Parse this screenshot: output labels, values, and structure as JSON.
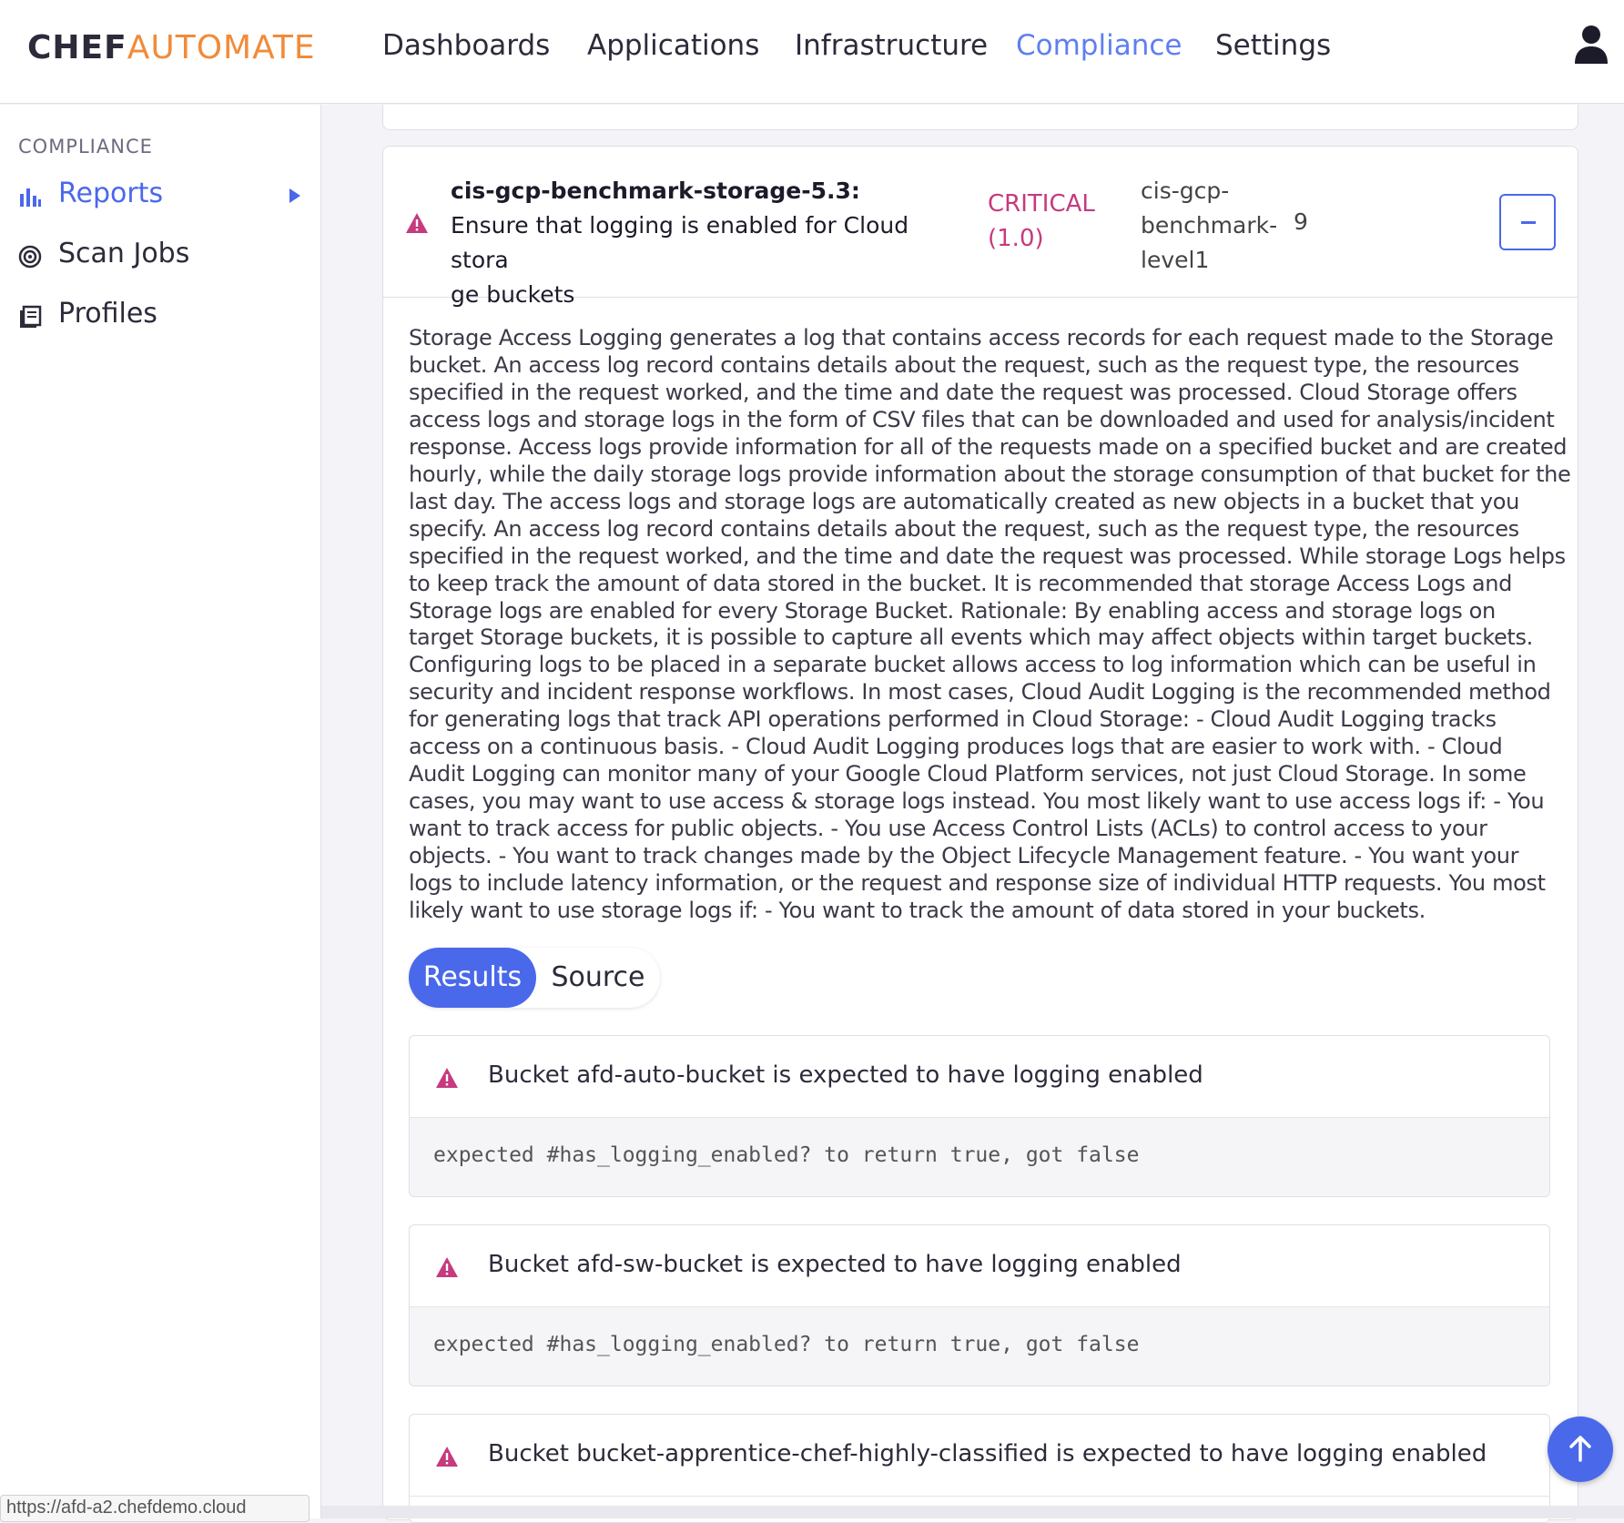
{
  "brand": {
    "part1": "CHEF",
    "part2": "AUTOMATE"
  },
  "nav": {
    "items": [
      {
        "label": "Dashboards",
        "active": false
      },
      {
        "label": "Applications",
        "active": false
      },
      {
        "label": "Infrastructure",
        "active": false
      },
      {
        "label": "Compliance",
        "active": true
      },
      {
        "label": "Settings",
        "active": false
      }
    ]
  },
  "sidebar": {
    "title": "COMPLIANCE",
    "items": [
      {
        "label": "Reports",
        "icon": "bar-chart-icon",
        "active": true
      },
      {
        "label": "Scan Jobs",
        "icon": "radar-icon",
        "active": false
      },
      {
        "label": "Profiles",
        "icon": "book-icon",
        "active": false
      }
    ]
  },
  "control": {
    "id": "cis-gcp-benchmark-storage-5.3:",
    "title_line1": "Ensure that logging is enabled for Cloud stora",
    "title_line2": "ge buckets",
    "impact_line1": "CRITICAL",
    "impact_line2": "(1.0)",
    "profile_line1": "cis-gcp-",
    "profile_line2": "benchmark-",
    "profile_line3": "level1",
    "count": "9",
    "description_lines": [
      "Storage Access Logging generates a log that contains access records for each request made to the Storage",
      "bucket. An access log record contains details about the request, such as the request type, the resources",
      "specified in the request worked, and the time and date the request was processed. Cloud Storage offers",
      "access logs and storage logs in the form of CSV files that can be downloaded and used for analysis/incident",
      "response. Access logs provide information for all of the requests made on a specified bucket and are created",
      "hourly, while the daily storage logs provide information about the storage consumption of that bucket for the",
      "last day. The access logs and storage logs are automatically created as new objects in a bucket that you",
      "specify. An access log record contains details about the request, such as the request type, the resources",
      "specified in the request worked, and the time and date the request was processed. While storage Logs helps",
      "to keep track the amount of data stored in the bucket. It is recommended that storage Access Logs and",
      "Storage logs are enabled for every Storage Bucket. Rationale: By enabling access and storage logs on",
      "target Storage buckets, it is possible to capture all events which may affect objects within target buckets.",
      "Configuring logs to be placed in a separate bucket allows access to log information which can be useful in",
      "security and incident response workflows. In most cases, Cloud Audit Logging is the recommended method",
      "for generating logs that track API operations performed in Cloud Storage: - Cloud Audit Logging tracks",
      "access on a continuous basis. - Cloud Audit Logging produces logs that are easier to work with. - Cloud",
      "Audit Logging can monitor many of your Google Cloud Platform services, not just Cloud Storage. In some",
      "cases, you may want to use access & storage logs instead. You most likely want to use access logs if: - You",
      "want to track access for public objects. - You use Access Control Lists (ACLs) to control access to your",
      "objects. - You want to track changes made by the Object Lifecycle Management feature. - You want your",
      "logs to include latency information, or the request and response size of individual HTTP requests. You most",
      "likely want to use storage logs if: - You want to track the amount of data stored in your buckets."
    ]
  },
  "tabs": {
    "results": "Results",
    "source": "Source"
  },
  "results": [
    {
      "title": "Bucket afd-auto-bucket is expected to have logging enabled",
      "message": "expected #has_logging_enabled? to return true, got false"
    },
    {
      "title": "Bucket afd-sw-bucket is expected to have logging enabled",
      "message": "expected #has_logging_enabled? to return true, got false"
    },
    {
      "title": "Bucket bucket-apprentice-chef-highly-classified is expected to have logging enabled",
      "message": ""
    }
  ],
  "status_url": "https://afd-a2.chefdemo.cloud",
  "colors": {
    "accent": "#4a68ea",
    "critical": "#c63a7e",
    "brand_orange": "#f18b3a"
  }
}
